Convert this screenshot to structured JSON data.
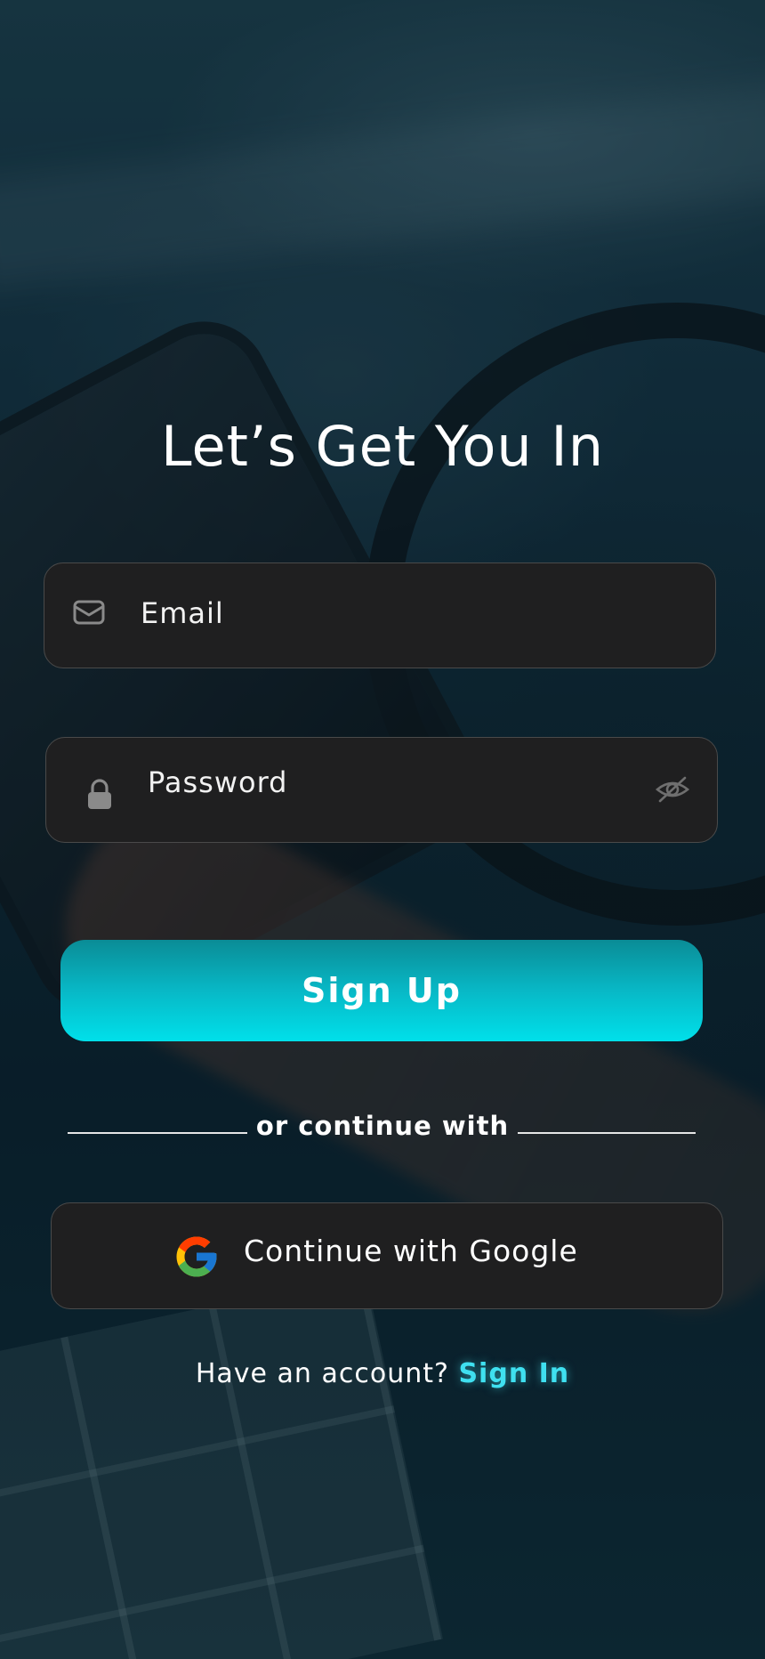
{
  "title": "Let’s Get You In",
  "email": {
    "placeholder": "Email",
    "value": "",
    "icon": "mail-icon"
  },
  "password": {
    "placeholder": "Password",
    "value": "",
    "icon": "lock-icon",
    "toggle_icon": "eye-off-icon"
  },
  "signup_button": {
    "label": "Sign Up"
  },
  "divider": {
    "text": "or continue with"
  },
  "google_button": {
    "label": "Continue with Google",
    "icon": "google-icon"
  },
  "footer": {
    "prompt": "Have an account?",
    "link": "Sign In"
  },
  "colors": {
    "accent": "#00e0ea",
    "accent_dark": "#0a8c96",
    "field_bg": "#1f1f20",
    "field_border": "#4a4a4a",
    "link": "#3fe0f0"
  }
}
